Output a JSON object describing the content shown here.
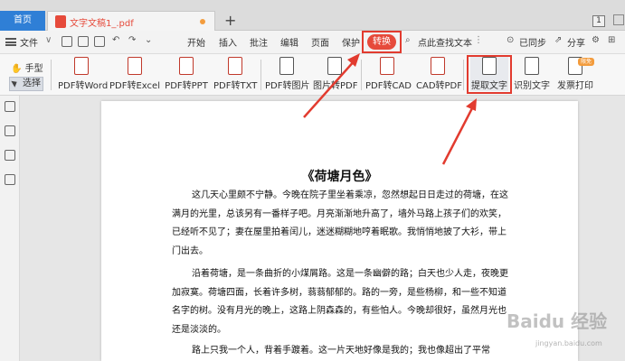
{
  "tabs": {
    "home": "首页",
    "document": "文字文稿1_.pdf",
    "add": "+",
    "window_count": "1"
  },
  "menu": {
    "file": "文件",
    "items": [
      "开始",
      "插入",
      "批注",
      "编辑",
      "页面",
      "保护"
    ],
    "active": "转换",
    "search_placeholder": "点此查找文本",
    "synced": "已同步",
    "share": "分享"
  },
  "ribbon": {
    "hand": "手型",
    "select": "选择",
    "buttons": [
      "PDF转Word",
      "PDF转Excel",
      "PDF转PPT",
      "PDF转TXT",
      "PDF转图片",
      "图片转PDF",
      "PDF转CAD",
      "CAD转PDF",
      "提取文字",
      "识别文字",
      "发票打印"
    ],
    "vip_badge": "限免"
  },
  "document": {
    "title": "《荷塘月色》",
    "paragraphs": [
      "这几天心里颇不宁静。今晚在院子里坐着乘凉，忽然想起日日走过的荷塘，在这满月的光里，总该另有一番样子吧。月亮渐渐地升高了，墙外马路上孩子们的欢笑，已经听不见了；妻在屋里拍着闰儿，迷迷糊糊地哼着眠歌。我悄悄地披了大衫，带上门出去。",
      "沿着荷塘，是一条曲折的小煤屑路。这是一条幽僻的路；白天也少人走，夜晚更加寂寞。荷塘四面，长着许多树，蓊蓊郁郁的。路的一旁，是些杨柳，和一些不知道名字的树。没有月光的晚上，这路上阴森森的，有些怕人。今晚却很好，虽然月光也还是淡淡的。",
      "路上只我一个人，背着手踱着。这一片天地好像是我的；我也像超出了平常"
    ]
  },
  "watermark": {
    "main": "Baidu 经验",
    "sub": "jingyan.baidu.com"
  },
  "colors": {
    "accent_red": "#e64a3b",
    "home_tab_blue": "#2f7fd6",
    "annotation_red": "#e23b2f"
  }
}
